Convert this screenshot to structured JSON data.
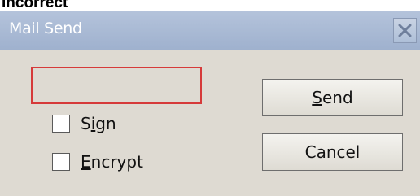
{
  "caption": "Incorrect",
  "dialog": {
    "title": "Mail Send",
    "close_icon": "close-x-icon",
    "input": {
      "value": "",
      "placeholder": ""
    },
    "checkboxes": [
      {
        "pre": "S",
        "mnemonic": "i",
        "post": "gn",
        "checked": false
      },
      {
        "pre": "",
        "mnemonic": "E",
        "post": "ncrypt",
        "checked": false
      }
    ],
    "buttons": [
      {
        "pre": "",
        "mnemonic": "S",
        "post": "end"
      },
      {
        "label": "Cancel"
      }
    ],
    "colors": {
      "error_border": "#d63a3a",
      "titlebar": "#a8b8d4",
      "background": "#dedad2"
    }
  }
}
